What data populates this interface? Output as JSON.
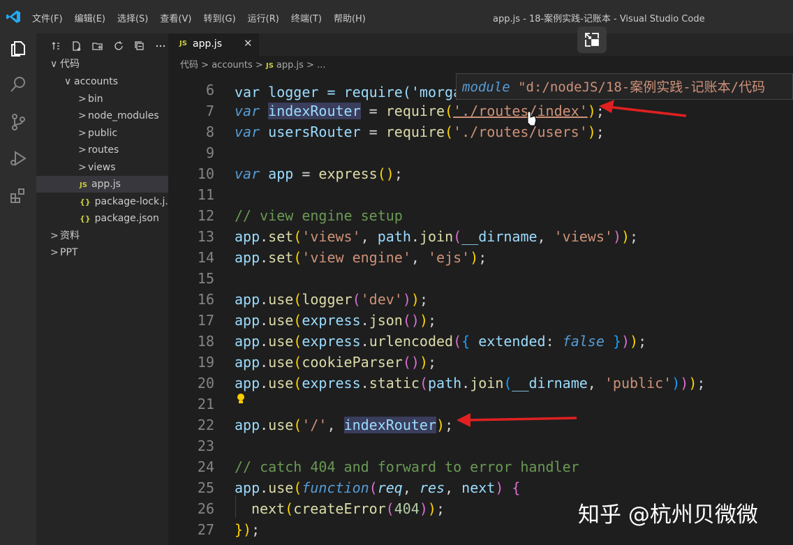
{
  "menu": [
    "文件(F)",
    "编辑(E)",
    "选择(S)",
    "查看(V)",
    "转到(G)",
    "运行(R)",
    "终端(T)",
    "帮助(H)"
  ],
  "window_title": "app.js - 18-案例实践-记账本 - Visual Studio Code",
  "explorer": {
    "root": "代码",
    "items": [
      {
        "label": "accounts",
        "depth": 1,
        "chev": "∨"
      },
      {
        "label": "bin",
        "depth": 2,
        "chev": ">"
      },
      {
        "label": "node_modules",
        "depth": 2,
        "chev": ">"
      },
      {
        "label": "public",
        "depth": 2,
        "chev": ">"
      },
      {
        "label": "routes",
        "depth": 2,
        "chev": ">"
      },
      {
        "label": "views",
        "depth": 2,
        "chev": ">"
      },
      {
        "label": "app.js",
        "depth": 2,
        "badge": "JS"
      },
      {
        "label": "package-lock.j...",
        "depth": 2,
        "badge": "{}"
      },
      {
        "label": "package.json",
        "depth": 2,
        "badge": "{}"
      },
      {
        "label": "资料",
        "depth": 0,
        "chev": ">"
      },
      {
        "label": "PPT",
        "depth": 0,
        "chev": ">"
      }
    ]
  },
  "tab": {
    "badge": "JS",
    "label": "app.js",
    "close": "✕"
  },
  "breadcrumb": {
    "parts": [
      "代码",
      "accounts"
    ],
    "sep": ">",
    "file": "app.js",
    "tail": "..."
  },
  "hover": {
    "keyword": "module",
    "text": "\"d:/nodeJS/18-案例实践-记账本/代码"
  },
  "code": {
    "partial_top": "var logger = require('morgan');",
    "lines": [
      {
        "n": "6",
        "text": ""
      },
      {
        "n": "7",
        "text": "var indexRouter = require('./routes/index');"
      },
      {
        "n": "8",
        "text": "var usersRouter = require('./routes/users');"
      },
      {
        "n": "9",
        "text": ""
      },
      {
        "n": "10",
        "text": "var app = express();"
      },
      {
        "n": "11",
        "text": ""
      },
      {
        "n": "12",
        "text": "// view engine setup"
      },
      {
        "n": "13",
        "text": "app.set('views', path.join(__dirname, 'views'));"
      },
      {
        "n": "14",
        "text": "app.set('view engine', 'ejs');"
      },
      {
        "n": "15",
        "text": ""
      },
      {
        "n": "16",
        "text": "app.use(logger('dev'));"
      },
      {
        "n": "17",
        "text": "app.use(express.json());"
      },
      {
        "n": "18",
        "text": "app.use(express.urlencoded({ extended: false }));"
      },
      {
        "n": "19",
        "text": "app.use(cookieParser());"
      },
      {
        "n": "20",
        "text": "app.use(express.static(path.join(__dirname, 'public')));"
      },
      {
        "n": "21",
        "text": ""
      },
      {
        "n": "22",
        "text": "app.use('/', indexRouter);"
      },
      {
        "n": "23",
        "text": ""
      },
      {
        "n": "24",
        "text": "// catch 404 and forward to error handler"
      },
      {
        "n": "25",
        "text": "app.use(function(req, res, next) {"
      },
      {
        "n": "26",
        "text": "next(createError(404));"
      },
      {
        "n": "27",
        "text": "});"
      }
    ]
  },
  "watermark": "知乎 @杭州贝微微",
  "colors": {
    "accent": "#007acc",
    "annotation_arrow": "#e02020"
  }
}
